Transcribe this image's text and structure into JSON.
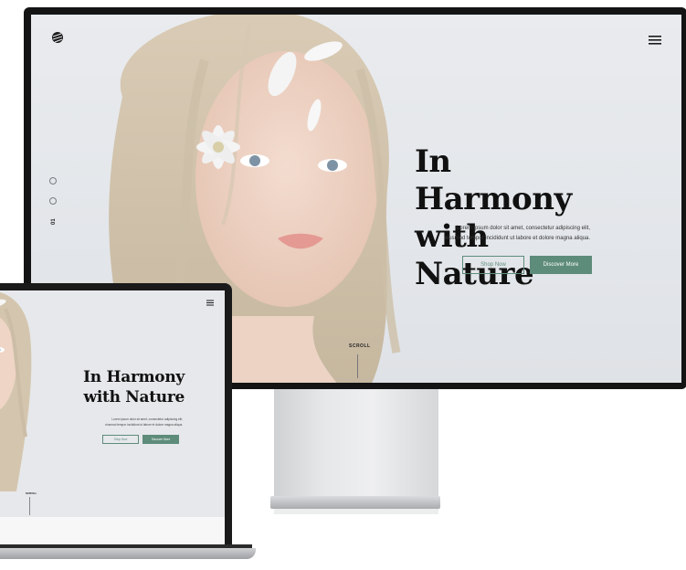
{
  "desktop": {
    "hero_title_line1": "In Harmony",
    "hero_title_line2": "with Nature",
    "hero_body_line1": "Lorem ipsum dolor sit amet, consectetur adipiscing elit,",
    "hero_body_line2": "eiusmod tempor incididunt ut labore et dolore magna aliqua.",
    "shop_button": "Shop Now",
    "discover_button": "Discover More",
    "scroll_label": "SCROLL",
    "slide_dots": [
      "1",
      "2",
      "3"
    ],
    "active_slide_label": "01"
  },
  "laptop": {
    "hero_title_line1": "In Harmony",
    "hero_title_line2": "with Nature",
    "hero_body_line1": "Lorem ipsum dolor sit amet, consectetur adipiscing elit,",
    "hero_body_line2": "eiusmod tempor incididunt ut labore et dolore magna aliqua.",
    "shop_button": "Shop Now",
    "discover_button": "Discover More",
    "scroll_label": "SCROLL"
  },
  "colors": {
    "accent": "#5e8c7a",
    "background": "#e6e8eb",
    "title": "#111111"
  },
  "icons": {
    "logo": "brand-logo-icon",
    "menu": "hamburger-menu-icon"
  }
}
